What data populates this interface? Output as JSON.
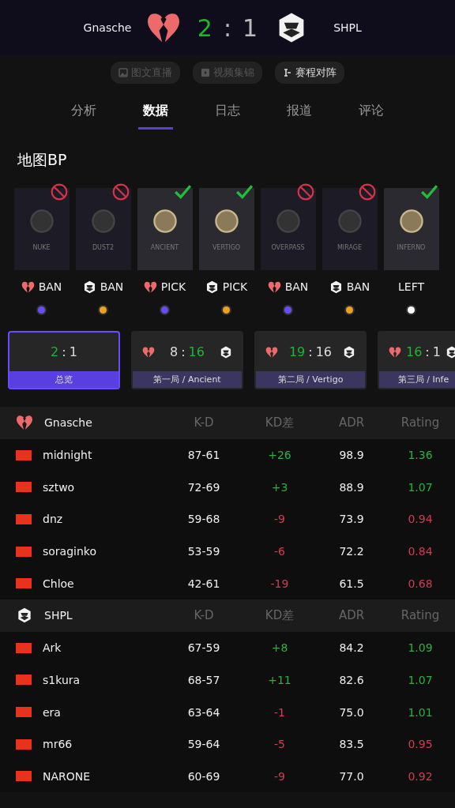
{
  "match": {
    "team_a": "Gnasche",
    "team_b": "SHPL",
    "score_a": "2",
    "separator": ":",
    "score_b": "1"
  },
  "links": [
    {
      "label": "图文直播",
      "kind": "image",
      "disabled": true
    },
    {
      "label": "视频集锦",
      "kind": "video",
      "disabled": true
    },
    {
      "label": "赛程对阵",
      "kind": "bracket",
      "disabled": false
    }
  ],
  "tabs": [
    {
      "label": "分析",
      "selected": false
    },
    {
      "label": "数据",
      "selected": true
    },
    {
      "label": "日志",
      "selected": false
    },
    {
      "label": "报道",
      "selected": false
    },
    {
      "label": "评论",
      "selected": false
    }
  ],
  "map_bp": {
    "title": "地图BP",
    "maps": [
      {
        "name": "NUKE",
        "kind": "ban",
        "actor": {
          "kind": "heart"
        },
        "action": "BAN",
        "color": "#6a4cff"
      },
      {
        "name": "DUST2",
        "kind": "ban",
        "actor": {
          "kind": "hexagon"
        },
        "action": "BAN",
        "color": "#f0a020"
      },
      {
        "name": "ANCIENT",
        "kind": "pick",
        "actor": {
          "kind": "heart"
        },
        "action": "PICK",
        "color": "#6a4cff"
      },
      {
        "name": "VERTIGO",
        "kind": "pick",
        "actor": {
          "kind": "hexagon"
        },
        "action": "PICK",
        "color": "#f0a020"
      },
      {
        "name": "OVERPASS",
        "kind": "ban",
        "actor": {
          "kind": "heart"
        },
        "action": "BAN",
        "color": "#6a4cff"
      },
      {
        "name": "MIRAGE",
        "kind": "ban",
        "actor": {
          "kind": "hexagon"
        },
        "action": "BAN",
        "color": "#f0a020"
      },
      {
        "name": "INFERNO",
        "kind": "pick",
        "action": "LEFT",
        "color": "#ffffff"
      }
    ]
  },
  "games": [
    {
      "label": "总览",
      "score_a": "2",
      "separator": ":",
      "score_b": "1",
      "left_won": true,
      "selected": true,
      "logos": false
    },
    {
      "label": "第一局 / Ancient",
      "score_a": "8",
      "separator": ":",
      "score_b": "16",
      "left_won": false,
      "selected": false,
      "logos": true
    },
    {
      "label": "第二局 / Vertigo",
      "score_a": "19",
      "separator": ":",
      "score_b": "16",
      "left_won": true,
      "selected": false,
      "logos": true
    },
    {
      "label": "第三局 / Infe",
      "score_a": "16",
      "separator": ":",
      "score_b": "1",
      "left_won": true,
      "selected": false,
      "logos": true
    }
  ],
  "teams": [
    {
      "name": "Gnasche",
      "logo": {
        "kind": "heart"
      },
      "columns": [
        "K-D",
        "KD差",
        "ADR",
        "Rating"
      ],
      "players": [
        {
          "name": "midnight",
          "kd": "87-61",
          "diff": "+26",
          "adr": "98.9",
          "rating": "1.36",
          "diff_positive": true,
          "rating_good": true
        },
        {
          "name": "sztwo",
          "kd": "72-69",
          "diff": "+3",
          "adr": "88.9",
          "rating": "1.07",
          "diff_positive": true,
          "rating_good": true
        },
        {
          "name": "dnz",
          "kd": "59-68",
          "diff": "-9",
          "adr": "73.9",
          "rating": "0.94",
          "diff_positive": false,
          "rating_good": false
        },
        {
          "name": "soraginko",
          "kd": "53-59",
          "diff": "-6",
          "adr": "72.2",
          "rating": "0.84",
          "diff_positive": false,
          "rating_good": false
        },
        {
          "name": "Chloe",
          "kd": "42-61",
          "diff": "-19",
          "adr": "61.5",
          "rating": "0.68",
          "diff_positive": false,
          "rating_good": false
        }
      ]
    },
    {
      "name": "SHPL",
      "logo": {
        "kind": "hexagon"
      },
      "columns": [
        "K-D",
        "KD差",
        "ADR",
        "Rating"
      ],
      "players": [
        {
          "name": "Ark",
          "kd": "67-59",
          "diff": "+8",
          "adr": "84.2",
          "rating": "1.09",
          "diff_positive": true,
          "rating_good": true
        },
        {
          "name": "s1kura",
          "kd": "68-57",
          "diff": "+11",
          "adr": "82.6",
          "rating": "1.07",
          "diff_positive": true,
          "rating_good": true
        },
        {
          "name": "era",
          "kd": "63-64",
          "diff": "-1",
          "adr": "75.0",
          "rating": "1.01",
          "diff_positive": false,
          "rating_good": true
        },
        {
          "name": "mr66",
          "kd": "59-64",
          "diff": "-5",
          "adr": "83.5",
          "rating": "0.95",
          "diff_positive": false,
          "rating_good": false
        },
        {
          "name": "NARONE",
          "kd": "60-69",
          "diff": "-9",
          "adr": "77.0",
          "rating": "0.92",
          "diff_positive": false,
          "rating_good": false
        }
      ]
    }
  ]
}
